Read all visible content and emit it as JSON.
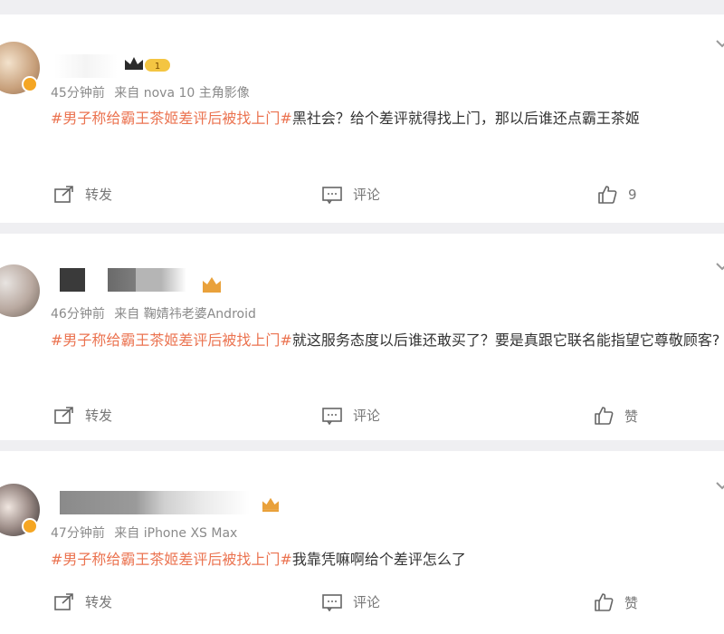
{
  "posts": [
    {
      "time": "45分钟前",
      "source": "来自 nova 10 主角影像",
      "level_badge": "1",
      "hashtag": "#男子称给霸王茶姬差评后被找上门#",
      "text": "黑社会？给个差评就得找上门，那以后谁还点霸王茶姬",
      "repost_label": "转发",
      "comment_label": "评论",
      "like_label": "9"
    },
    {
      "time": "46分钟前",
      "source": "来自 鞠婧祎老婆Android",
      "hashtag": "#男子称给霸王茶姬差评后被找上门#",
      "text": "就这服务态度以后谁还敢买了？要是真跟它联名能指望它尊敬顾客?",
      "repost_label": "转发",
      "comment_label": "评论",
      "like_label": "赞"
    },
    {
      "time": "47分钟前",
      "source": "来自 iPhone XS Max",
      "hashtag": "#男子称给霸王茶姬差评后被找上门#",
      "text": "我靠凭嘛啊给个差评怎么了",
      "repost_label": "转发",
      "comment_label": "评论",
      "like_label": "赞"
    }
  ],
  "colors": {
    "hashtag": "#eb7350",
    "meta": "#8a8a8a",
    "background": "#efeff2",
    "vip_gold": "#f5a623"
  }
}
